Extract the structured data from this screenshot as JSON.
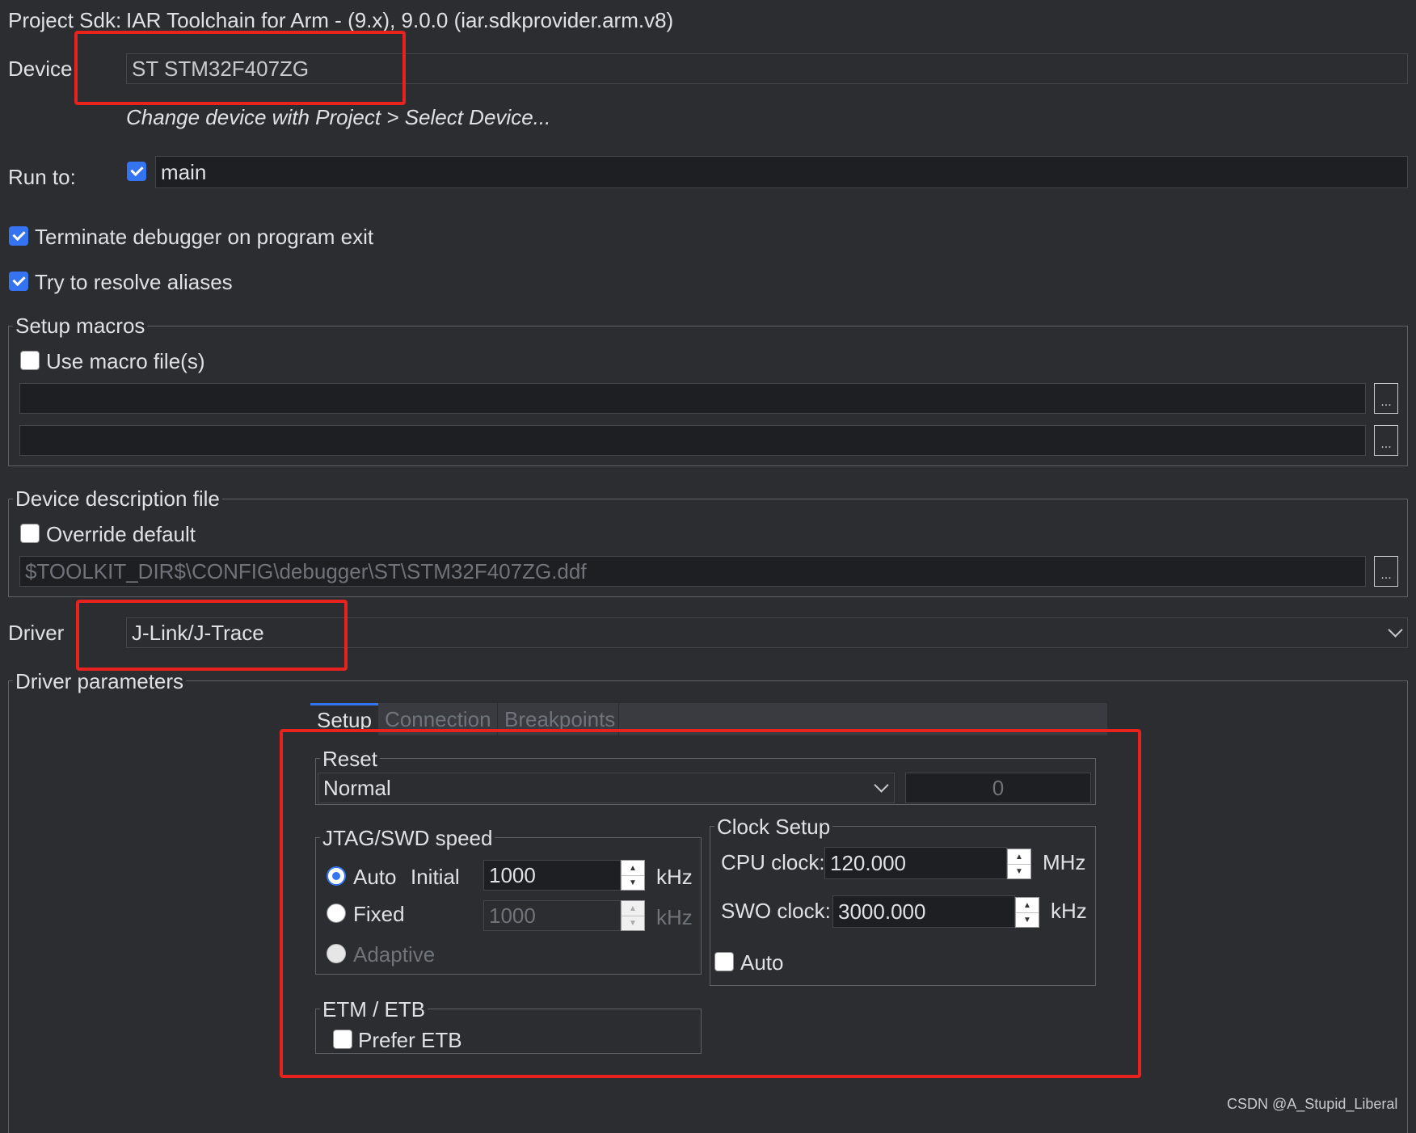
{
  "project_sdk": {
    "label": "Project Sdk:",
    "value": "IAR Toolchain for Arm - (9.x), 9.0.0 (iar.sdkprovider.arm.v8)"
  },
  "device": {
    "label": "Device",
    "value": "ST STM32F407ZG",
    "hint": "Change device with Project > Select Device..."
  },
  "run_to": {
    "label": "Run to:",
    "checked": true,
    "value": "main"
  },
  "options": {
    "terminate": {
      "label": "Terminate debugger on program exit",
      "checked": true
    },
    "resolve_aliases": {
      "label": "Try to resolve aliases",
      "checked": true
    }
  },
  "setup_macros": {
    "legend": "Setup macros",
    "use_macro_label": "Use macro file(s)",
    "use_macro_checked": false,
    "file1": "",
    "file2": "",
    "browse_label": "..."
  },
  "device_desc": {
    "legend": "Device description file",
    "override_label": "Override default",
    "override_checked": false,
    "path": "$TOOLKIT_DIR$\\CONFIG\\debugger\\ST\\STM32F407ZG.ddf",
    "browse_label": "..."
  },
  "driver": {
    "label": "Driver",
    "value": "J-Link/J-Trace"
  },
  "driver_params": {
    "legend": "Driver parameters",
    "tabs": [
      "Setup",
      "Connection",
      "Breakpoints"
    ],
    "active_tab": "Setup",
    "reset": {
      "legend": "Reset",
      "mode": "Normal",
      "delay": "0"
    },
    "jtag": {
      "legend": "JTAG/SWD speed",
      "auto_label": "Auto",
      "initial_label": "Initial",
      "initial_value": "1000",
      "fixed_label": "Fixed",
      "fixed_value": "1000",
      "adaptive_label": "Adaptive",
      "unit": "kHz",
      "selected": "Auto"
    },
    "clock": {
      "legend": "Clock Setup",
      "cpu_label": "CPU clock:",
      "cpu_value": "120.000",
      "cpu_unit": "MHz",
      "swo_label": "SWO clock:",
      "swo_value": "3000.000",
      "swo_unit": "kHz",
      "auto_label": "Auto",
      "auto_checked": false
    },
    "etm": {
      "legend": "ETM / ETB",
      "prefer_label": "Prefer ETB",
      "prefer_checked": false
    }
  },
  "watermark": "CSDN @A_Stupid_Liberal",
  "colors": {
    "accent": "#3574f0",
    "highlight": "#e8221f",
    "background": "#2b2d30",
    "field": "#1e1f22"
  }
}
